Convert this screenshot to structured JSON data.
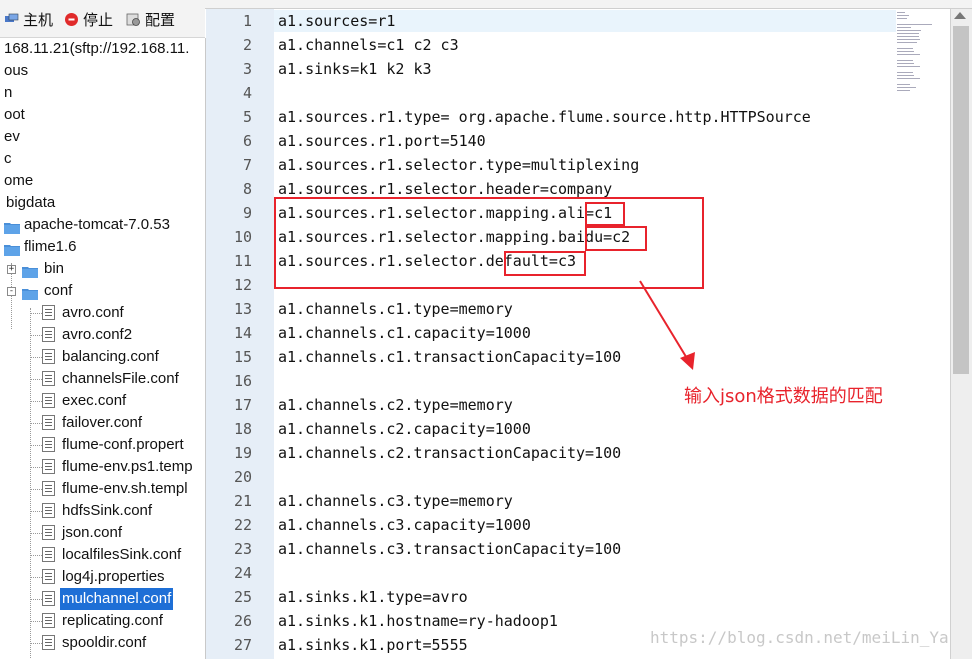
{
  "toolbar": {
    "host_label": "主机",
    "stop_label": "停止",
    "config_label": "配置"
  },
  "tree": {
    "rows": [
      {
        "label": "168.11.21(sftp://192.168.11."
      },
      {
        "label": "ous"
      },
      {
        "label": "n"
      },
      {
        "label": "oot"
      },
      {
        "label": "ev"
      },
      {
        "label": "c"
      },
      {
        "label": "ome"
      },
      {
        "label": "bigdata"
      },
      {
        "label": "apache-tomcat-7.0.53"
      },
      {
        "label": "flime1.6"
      },
      {
        "label": "bin"
      },
      {
        "label": "conf"
      },
      {
        "label": "avro.conf"
      },
      {
        "label": "avro.conf2"
      },
      {
        "label": "balancing.conf"
      },
      {
        "label": "channelsFile.conf"
      },
      {
        "label": "exec.conf"
      },
      {
        "label": "failover.conf"
      },
      {
        "label": "flume-conf.propert"
      },
      {
        "label": "flume-env.ps1.temp"
      },
      {
        "label": "flume-env.sh.templ"
      },
      {
        "label": "hdfsSink.conf"
      },
      {
        "label": "json.conf"
      },
      {
        "label": "localfilesSink.conf"
      },
      {
        "label": "log4j.properties"
      },
      {
        "label": "mulchannel.conf"
      },
      {
        "label": "replicating.conf"
      },
      {
        "label": "spooldir.conf"
      }
    ]
  },
  "editor": {
    "lines": [
      {
        "n": "1",
        "text": "a1.sources=r1"
      },
      {
        "n": "2",
        "text": "a1.channels=c1 c2 c3"
      },
      {
        "n": "3",
        "text": "a1.sinks=k1 k2 k3"
      },
      {
        "n": "4",
        "text": ""
      },
      {
        "n": "5",
        "text": "a1.sources.r1.type= org.apache.flume.source.http.HTTPSource"
      },
      {
        "n": "6",
        "text": "a1.sources.r1.port=5140"
      },
      {
        "n": "7",
        "text": "a1.sources.r1.selector.type=multiplexing"
      },
      {
        "n": "8",
        "text": "a1.sources.r1.selector.header=company"
      },
      {
        "n": "9",
        "text": "a1.sources.r1.selector.mapping.ali=c1"
      },
      {
        "n": "10",
        "text": "a1.sources.r1.selector.mapping.baidu=c2"
      },
      {
        "n": "11",
        "text": "a1.sources.r1.selector.default=c3"
      },
      {
        "n": "12",
        "text": ""
      },
      {
        "n": "13",
        "text": "a1.channels.c1.type=memory"
      },
      {
        "n": "14",
        "text": "a1.channels.c1.capacity=1000"
      },
      {
        "n": "15",
        "text": "a1.channels.c1.transactionCapacity=100"
      },
      {
        "n": "16",
        "text": ""
      },
      {
        "n": "17",
        "text": "a1.channels.c2.type=memory"
      },
      {
        "n": "18",
        "text": "a1.channels.c2.capacity=1000"
      },
      {
        "n": "19",
        "text": "a1.channels.c2.transactionCapacity=100"
      },
      {
        "n": "20",
        "text": ""
      },
      {
        "n": "21",
        "text": "a1.channels.c3.type=memory"
      },
      {
        "n": "22",
        "text": "a1.channels.c3.capacity=1000"
      },
      {
        "n": "23",
        "text": "a1.channels.c3.transactionCapacity=100"
      },
      {
        "n": "24",
        "text": ""
      },
      {
        "n": "25",
        "text": "a1.sinks.k1.type=avro"
      },
      {
        "n": "26",
        "text": "a1.sinks.k1.hostname=ry-hadoop1"
      },
      {
        "n": "27",
        "text": "a1.sinks.k1.port=5555"
      }
    ]
  },
  "annotation": "输入json格式数据的匹配",
  "watermark": "https://blog.csdn.net/meiLin_Ya",
  "colors": {
    "annotation_red": "#e8232c",
    "selection_blue": "#1e6fd6",
    "gutter_bg": "#e6eef7"
  }
}
